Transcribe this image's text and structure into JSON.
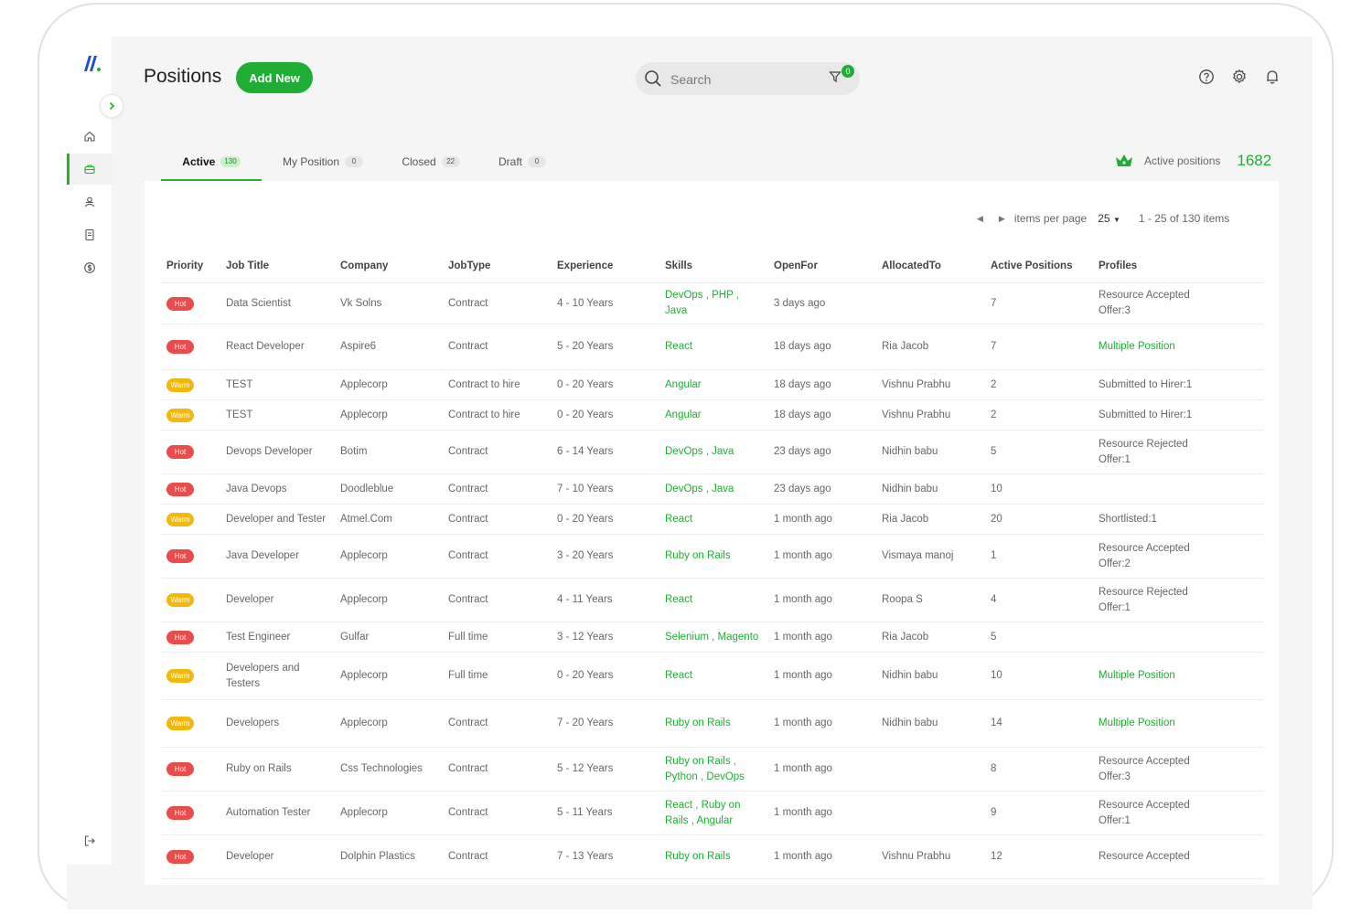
{
  "header": {
    "title": "Positions",
    "add_new_label": "Add New",
    "search_placeholder": "Search",
    "filter_count": "0"
  },
  "tabs": [
    {
      "label": "Active",
      "count": "130"
    },
    {
      "label": "My Position",
      "count": "0"
    },
    {
      "label": "Closed",
      "count": "22"
    },
    {
      "label": "Draft",
      "count": "0"
    }
  ],
  "summary": {
    "label": "Active positions",
    "value": "1682"
  },
  "pagination": {
    "items_per_page_label": "items per page",
    "page_size": "25",
    "range_text": "1 - 25 of 130 items"
  },
  "table": {
    "columns": [
      "Priority",
      "Job Title",
      "Company",
      "JobType",
      "Experience",
      "Skills",
      "OpenFor",
      "AllocatedTo",
      "Active Positions",
      "Profiles"
    ],
    "rows": [
      {
        "priority": "Hot",
        "job_title": "Data Scientist",
        "company": "Vk Solns",
        "job_type": "Contract",
        "experience": "4 - 10 Years",
        "skills": "DevOps , PHP , Java",
        "open_for": "3 days ago",
        "allocated_to": "",
        "active_positions": "7",
        "profiles": [
          "Resource Accepted",
          "Offer:3"
        ],
        "profiles_link": false
      },
      {
        "priority": "Hot",
        "job_title": "React Developer",
        "company": "Aspire6",
        "job_type": "Contract",
        "experience": "5 - 20 Years",
        "skills": "React",
        "open_for": "18 days ago",
        "allocated_to": "Ria Jacob",
        "active_positions": "7",
        "profiles": [
          "Multiple Position"
        ],
        "profiles_link": true
      },
      {
        "priority": "Warm",
        "job_title": "TEST",
        "company": "Applecorp",
        "job_type": "Contract to hire",
        "experience": "0 - 20 Years",
        "skills": "Angular",
        "open_for": "18 days ago",
        "allocated_to": "Vishnu Prabhu",
        "active_positions": "2",
        "profiles": [
          "Submitted to Hirer:1"
        ],
        "profiles_link": false
      },
      {
        "priority": "Warm",
        "job_title": "TEST",
        "company": "Applecorp",
        "job_type": "Contract to hire",
        "experience": "0 - 20 Years",
        "skills": "Angular",
        "open_for": "18 days ago",
        "allocated_to": "Vishnu Prabhu",
        "active_positions": "2",
        "profiles": [
          "Submitted to Hirer:1"
        ],
        "profiles_link": false
      },
      {
        "priority": "Hot",
        "job_title": "Devops Developer",
        "company": "Botim",
        "job_type": "Contract",
        "experience": "6 - 14 Years",
        "skills": "DevOps , Java",
        "open_for": "23 days ago",
        "allocated_to": "Nidhin babu",
        "active_positions": "5",
        "profiles": [
          "Resource Rejected",
          "Offer:1"
        ],
        "profiles_link": false
      },
      {
        "priority": "Hot",
        "job_title": "Java Devops",
        "company": "Doodleblue",
        "job_type": "Contract",
        "experience": "7 - 10 Years",
        "skills": "DevOps , Java",
        "open_for": "23 days ago",
        "allocated_to": "Nidhin babu",
        "active_positions": "10",
        "profiles": [],
        "profiles_link": false
      },
      {
        "priority": "Warm",
        "job_title": "Developer and Tester",
        "company": "Atmel.Com",
        "job_type": "Contract",
        "experience": "0 - 20 Years",
        "skills": "React",
        "open_for": "1 month ago",
        "allocated_to": "Ria Jacob",
        "active_positions": "20",
        "profiles": [
          "Shortlisted:1"
        ],
        "profiles_link": false
      },
      {
        "priority": "Hot",
        "job_title": "Java Developer",
        "company": "Applecorp",
        "job_type": "Contract",
        "experience": "3 - 20 Years",
        "skills": "Ruby on Rails",
        "open_for": "1 month ago",
        "allocated_to": "Vismaya manoj",
        "active_positions": "1",
        "profiles": [
          "Resource Accepted",
          "Offer:2"
        ],
        "profiles_link": false
      },
      {
        "priority": "Warm",
        "job_title": "Developer",
        "company": "Applecorp",
        "job_type": "Contract",
        "experience": "4 - 11 Years",
        "skills": "React",
        "open_for": "1 month ago",
        "allocated_to": "Roopa S",
        "active_positions": "4",
        "profiles": [
          "Resource Rejected",
          "Offer:1"
        ],
        "profiles_link": false
      },
      {
        "priority": "Hot",
        "job_title": "Test Engineer",
        "company": "Gulfar",
        "job_type": "Full time",
        "experience": "3 - 12 Years",
        "skills": "Selenium , Magento",
        "open_for": "1 month ago",
        "allocated_to": "Ria Jacob",
        "active_positions": "5",
        "profiles": [],
        "profiles_link": false
      },
      {
        "priority": "Warm",
        "job_title": "Developers and Testers",
        "company": "Applecorp",
        "job_type": "Full time",
        "experience": "0 - 20 Years",
        "skills": "React",
        "open_for": "1 month ago",
        "allocated_to": "Nidhin babu",
        "active_positions": "10",
        "profiles": [
          "Multiple Position"
        ],
        "profiles_link": true
      },
      {
        "priority": "Warm",
        "job_title": "Developers",
        "company": "Applecorp",
        "job_type": "Contract",
        "experience": "7 - 20 Years",
        "skills": "Ruby on Rails",
        "open_for": "1 month ago",
        "allocated_to": "Nidhin babu",
        "active_positions": "14",
        "profiles": [
          "Multiple Position"
        ],
        "profiles_link": true
      },
      {
        "priority": "Hot",
        "job_title": "Ruby on Rails",
        "company": "Css Technologies",
        "job_type": "Contract",
        "experience": "5 - 12 Years",
        "skills": "Ruby on Rails , Python , DevOps",
        "open_for": "1 month ago",
        "allocated_to": "",
        "active_positions": "8",
        "profiles": [
          "Resource Accepted",
          "Offer:3"
        ],
        "profiles_link": false
      },
      {
        "priority": "Hot",
        "job_title": "Automation Tester",
        "company": "Applecorp",
        "job_type": "Contract",
        "experience": "5 - 11 Years",
        "skills": "React , Ruby on Rails , Angular",
        "open_for": "1 month ago",
        "allocated_to": "",
        "active_positions": "9",
        "profiles": [
          "Resource Accepted",
          "Offer:1"
        ],
        "profiles_link": false
      },
      {
        "priority": "Hot",
        "job_title": "Developer",
        "company": "Dolphin Plastics",
        "job_type": "Contract",
        "experience": "7 - 13 Years",
        "skills": "Ruby on Rails",
        "open_for": "1 month ago",
        "allocated_to": "Vishnu Prabhu",
        "active_positions": "12",
        "profiles": [
          "Resource Accepted"
        ],
        "profiles_link": false
      }
    ]
  },
  "colors": {
    "accent_green": "#1fae33",
    "hot": "#ea4c4c",
    "warm": "#f2b90d"
  },
  "icons": {
    "logo": "brand-logo-icon",
    "collapse": "chevron-right-icon",
    "nav": [
      "home-icon",
      "briefcase-icon",
      "users-icon",
      "document-icon",
      "dollar-icon"
    ],
    "logout": "logout-icon",
    "search": "search-icon",
    "filter": "filter-icon",
    "help": "help-icon",
    "settings": "gear-icon",
    "notifications": "bell-icon",
    "crown": "crown-icon"
  }
}
